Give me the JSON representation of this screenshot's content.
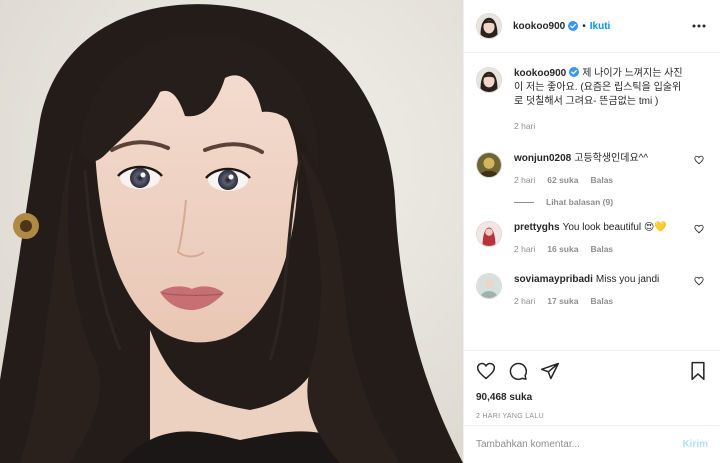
{
  "post": {
    "author": {
      "username": "kookoo900",
      "verified": true,
      "follow_label": "Ikuti",
      "separator": "•"
    },
    "caption": {
      "username": "kookoo900",
      "text": "제 나이가 느껴지는 사진이 저는 좋아요. (요즘은 립스틱을 입술위로 덧칠해서 그려요- 뜬금없는 tmi )",
      "time": "2 hari"
    },
    "comments": [
      {
        "username": "wonjun0208",
        "text": "고등학생인데요^^",
        "time": "2 hari",
        "likes": "62 suka",
        "reply": "Balas",
        "view_replies": "Lihat balasan (9)",
        "avatar_color": "#b7963c"
      },
      {
        "username": "prettyghs",
        "text": "You look beautiful 😍💛",
        "time": "2 hari",
        "likes": "16 suka",
        "reply": "Balas",
        "avatar_color": "#c95b5f"
      },
      {
        "username": "soviamaypribadi",
        "text": "Miss you jandi",
        "time": "2 hari",
        "likes": "17 suka",
        "reply": "Balas",
        "avatar_color": "#b9c6c2"
      }
    ],
    "likes_count": "90,468 suka",
    "posted_ago": "2 HARI YANG LALU",
    "comment_input": {
      "placeholder": "Tambahkan komentar...",
      "value": ""
    },
    "post_button": "Kirim"
  },
  "icons": {
    "verified": "verified-badge-icon",
    "more": "more-options-icon",
    "like": "heart-icon",
    "comment": "comment-icon",
    "share": "share-icon",
    "save": "bookmark-icon",
    "comment_like": "small-heart-icon"
  },
  "colors": {
    "link_blue": "#0095f6",
    "muted": "#8e8e8e",
    "post_disabled": "#b2dffc",
    "border": "#efefef"
  }
}
